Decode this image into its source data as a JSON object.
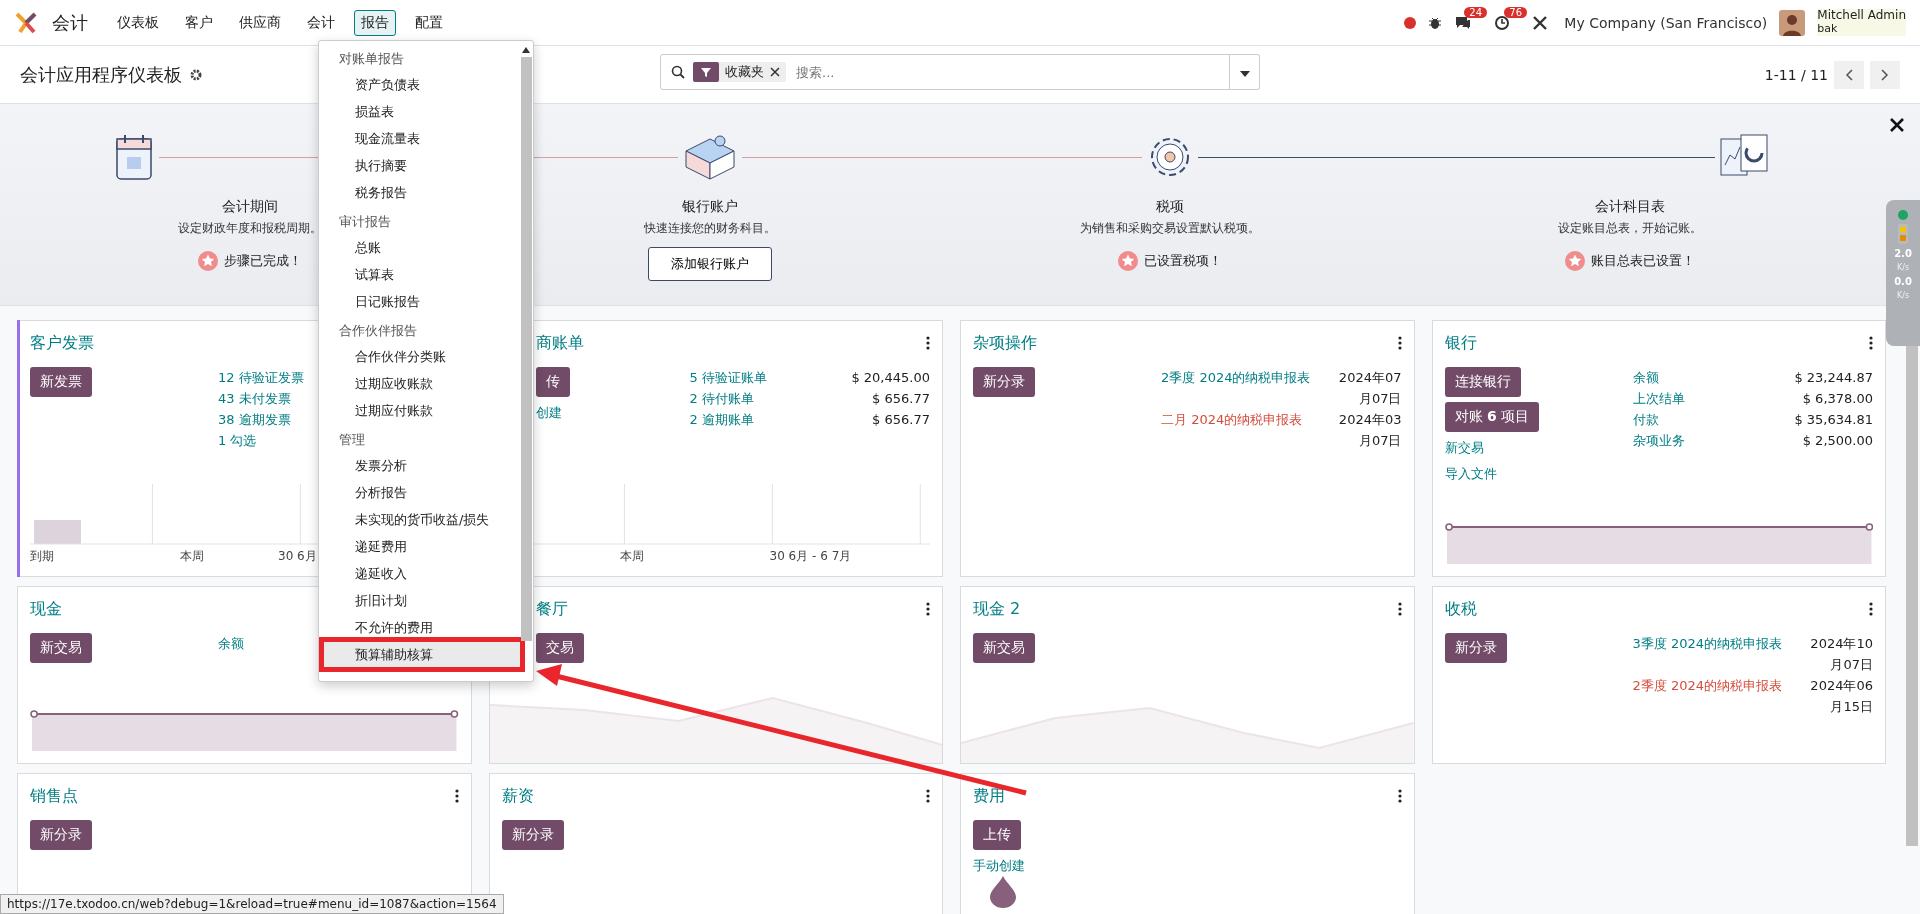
{
  "navbar": {
    "app": "会计",
    "menu": [
      {
        "label": "仪表板",
        "selected": false
      },
      {
        "label": "客户",
        "selected": false
      },
      {
        "label": "供应商",
        "selected": false
      },
      {
        "label": "会计",
        "selected": false
      },
      {
        "label": "报告",
        "selected": true
      },
      {
        "label": "配置",
        "selected": false
      }
    ],
    "messages_badge": "24",
    "activities_badge": "76",
    "company": "My Company (San Francisco)",
    "user": "Mitchell Admin",
    "database": "bak"
  },
  "control_panel": {
    "title": "会计应用程序仪表板",
    "filter": "收藏夹",
    "search_placeholder": "搜索...",
    "pager": "1-11 / 11"
  },
  "onboarding": {
    "steps": [
      {
        "title": "会计期间",
        "description": "设定财政年度和报税周期。",
        "done": true,
        "status": "步骤已完成！"
      },
      {
        "title": "银行账户",
        "description": "快速连接您的财务科目。",
        "done": false,
        "action": "添加银行账户"
      },
      {
        "title": "税项",
        "description": "为销售和采购交易设置默认税项。",
        "done": true,
        "status": "已设置税项！"
      },
      {
        "title": "会计科目表",
        "description": "设定账目总表，开始记账。",
        "done": true,
        "status": "账目总表已设置！"
      }
    ]
  },
  "cards": [
    {
      "title": "客户发票",
      "highlighted": true,
      "buttons": [
        "新发票"
      ],
      "stats": [
        {
          "label": "12 待验证发票"
        },
        {
          "label": "43 未付发票"
        },
        {
          "label": "38 逾期发票"
        },
        {
          "label": "1 勾选"
        }
      ],
      "chart": {
        "kind": "bars",
        "labels": [
          "到期",
          "本周",
          "30 6月"
        ]
      }
    },
    {
      "title": "商账单",
      "highlighted": false,
      "buttons": [
        "传"
      ],
      "links": [
        "创建"
      ],
      "stats": [
        {
          "label": "5 待验证账单",
          "amount": "$ 20,445.00"
        },
        {
          "label": "2 待付账单",
          "amount": "$ 656.77"
        },
        {
          "label": "2 逾期账单",
          "amount": "$ 656.77"
        }
      ],
      "chart": {
        "kind": "bars",
        "labels": [
          "本周",
          "30 6月 - 6 7月"
        ]
      }
    },
    {
      "title": "杂项操作",
      "highlighted": false,
      "buttons": [
        "新分录"
      ],
      "entries": [
        {
          "label": "2季度 2024的纳税申报表",
          "date": "2024年07月07日",
          "overdue": false
        },
        {
          "label": "二月 2024的纳税申报表",
          "date": "2024年03月07日",
          "overdue": true
        }
      ]
    },
    {
      "title": "银行",
      "highlighted": false,
      "buttons": [
        "连接银行",
        "对账 **6** 项目"
      ],
      "links": [
        "新交易",
        "导入文件"
      ],
      "stats": [
        {
          "label": "余额",
          "amount": "$ 23,244.87"
        },
        {
          "label": "上次结单",
          "amount": "$ 6,378.00"
        },
        {
          "label": "付款",
          "amount": "$ 35,634.81"
        },
        {
          "label": "杂项业务",
          "amount": "$ 2,500.00"
        }
      ],
      "chart": {
        "kind": "flat"
      }
    },
    {
      "title": "现金",
      "highlighted": false,
      "buttons": [
        "新交易"
      ],
      "stats": [
        {
          "label": "余额"
        }
      ],
      "chart": {
        "kind": "flat"
      }
    },
    {
      "title": "餐厅",
      "highlighted": false,
      "buttons": [
        "交易"
      ],
      "chart": {
        "kind": "area"
      }
    },
    {
      "title": "现金 2",
      "highlighted": false,
      "buttons": [
        "新交易"
      ],
      "chart": {
        "kind": "area"
      }
    },
    {
      "title": "收税",
      "highlighted": false,
      "buttons": [
        "新分录"
      ],
      "entries": [
        {
          "label": "3季度 2024的纳税申报表",
          "date": "2024年10月07日",
          "overdue": false
        },
        {
          "label": "2季度 2024的纳税申报表",
          "date": "2024年06月15日",
          "overdue": true
        }
      ]
    },
    {
      "title": "销售点",
      "highlighted": false,
      "buttons": [
        "新分录"
      ]
    },
    {
      "title": "薪资",
      "highlighted": false,
      "buttons": [
        "新分录"
      ]
    },
    {
      "title": "费用",
      "highlighted": false,
      "buttons": [
        "上传"
      ],
      "links": [
        "手动创建"
      ]
    }
  ],
  "reports_menu": {
    "sections": [
      {
        "heading": "对账单报告",
        "items": [
          {
            "label": "资产负债表",
            "selected": false,
            "annotated": false
          },
          {
            "label": "损益表",
            "selected": false,
            "annotated": false
          },
          {
            "label": "现金流量表",
            "selected": false,
            "annotated": false
          },
          {
            "label": "执行摘要",
            "selected": false,
            "annotated": false
          },
          {
            "label": "税务报告",
            "selected": false,
            "annotated": false
          }
        ]
      },
      {
        "heading": "审计报告",
        "items": [
          {
            "label": "总账",
            "selected": false,
            "annotated": false
          },
          {
            "label": "试算表",
            "selected": false,
            "annotated": false
          },
          {
            "label": "日记账报告",
            "selected": false,
            "annotated": false
          }
        ]
      },
      {
        "heading": "合作伙伴报告",
        "items": [
          {
            "label": "合作伙伴分类账",
            "selected": false,
            "annotated": false
          },
          {
            "label": "过期应收账款",
            "selected": false,
            "annotated": false
          },
          {
            "label": "过期应付账款",
            "selected": false,
            "annotated": false
          }
        ]
      },
      {
        "heading": "管理",
        "items": [
          {
            "label": "发票分析",
            "selected": false,
            "annotated": false
          },
          {
            "label": "分析报告",
            "selected": false,
            "annotated": false
          },
          {
            "label": "未实现的货币收益/损失",
            "selected": false,
            "annotated": false
          },
          {
            "label": "递延费用",
            "selected": false,
            "annotated": false
          },
          {
            "label": "递延收入",
            "selected": false,
            "annotated": false
          },
          {
            "label": "折旧计划",
            "selected": false,
            "annotated": false
          },
          {
            "label": "不允许的费用",
            "selected": false,
            "annotated": false
          },
          {
            "label": "预算辅助核算",
            "selected": true,
            "annotated": true
          }
        ]
      }
    ]
  },
  "speed_widget": {
    "upload": "2.0",
    "upload_unit": "K/s",
    "download": "0.0",
    "download_unit": "K/s"
  },
  "status_url": "https://17e.txodoo.cn/web?debug=1&reload=true#menu_id=1087&action=1564"
}
